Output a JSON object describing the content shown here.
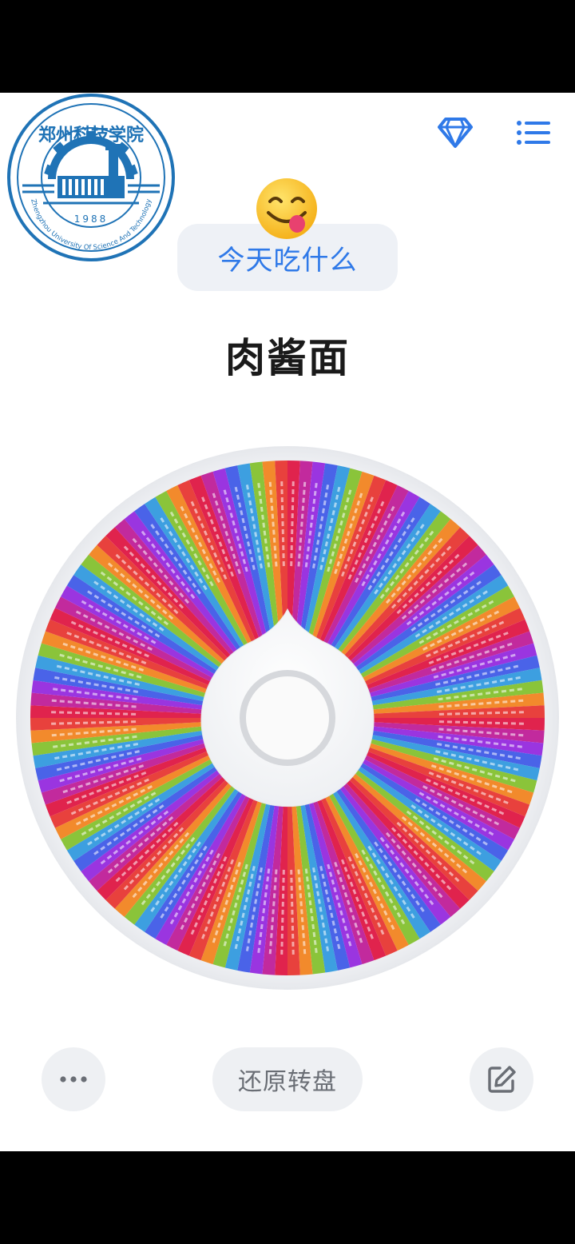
{
  "header": {
    "logo": {
      "name_cn": "郑州科技学院",
      "name_en": "Zhengzhou University Of Science And Technology",
      "year": "1988"
    },
    "icons": [
      "diamond-icon",
      "menu-list-icon"
    ]
  },
  "title": {
    "label": "今天吃什么",
    "emoji": "yum-face"
  },
  "result": "肉酱面",
  "wheel": {
    "segment_count": 128,
    "palette": [
      "#e0234d",
      "#c22a9d",
      "#9a35e0",
      "#4a63e8",
      "#3d9fe0",
      "#8ac43a",
      "#f28a2c",
      "#e8413d"
    ],
    "label_color": "#ffffff"
  },
  "footer": {
    "more_icon": "more-dots-icon",
    "reset_label": "还原转盘",
    "edit_icon": "edit-icon"
  },
  "colors": {
    "accent": "#2f79e8",
    "pill_bg": "#eef1f6",
    "button_bg": "#eef0f3"
  }
}
